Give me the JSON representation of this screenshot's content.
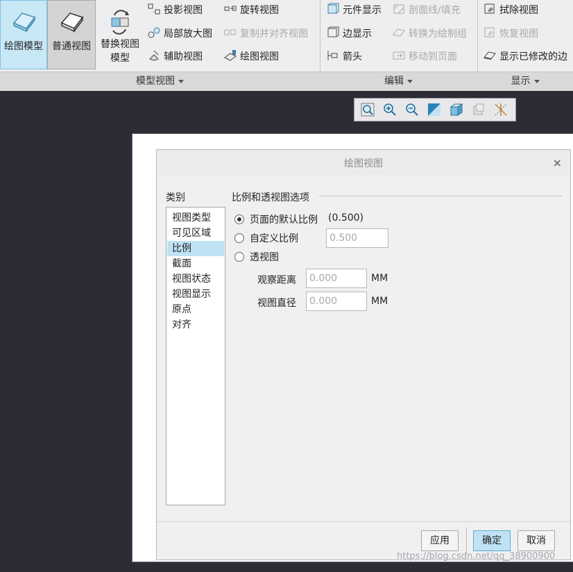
{
  "ribbon": {
    "big_buttons": [
      {
        "label": "绘图模型",
        "state": "active"
      },
      {
        "label": "普通视图",
        "state": "pressed"
      },
      {
        "label": "替换视图\n模型",
        "state": "normal"
      }
    ],
    "model_view_items": [
      {
        "label": "投影视图",
        "disabled": false
      },
      {
        "label": "局部放大图",
        "disabled": false
      },
      {
        "label": "辅助视图",
        "disabled": false
      },
      {
        "label": "旋转视图",
        "disabled": false
      },
      {
        "label": "复制并对齐视图",
        "disabled": true
      },
      {
        "label": "绘图视图",
        "disabled": false
      }
    ],
    "edit_items": [
      {
        "label": "元件显示",
        "disabled": false
      },
      {
        "label": "边显示",
        "disabled": false
      },
      {
        "label": "箭头",
        "disabled": false
      },
      {
        "label": "剖面线/填充",
        "disabled": true
      },
      {
        "label": "转换为绘制组",
        "disabled": true
      },
      {
        "label": "移动到页面",
        "disabled": true
      }
    ],
    "display_items": [
      {
        "label": "拭除视图",
        "disabled": false
      },
      {
        "label": "恢复视图",
        "disabled": true
      },
      {
        "label": "显示已修改的边",
        "disabled": false
      }
    ],
    "groups": [
      {
        "label": "模型视图"
      },
      {
        "label": "编辑"
      },
      {
        "label": "显示"
      }
    ]
  },
  "mini_toolbar": {
    "icons": [
      "zoom-fit-icon",
      "zoom-in-icon",
      "zoom-out-icon",
      "repaint-icon",
      "display-style-icon",
      "saved-views-icon",
      "datum-display-icon"
    ]
  },
  "dialog": {
    "title": "绘图视图",
    "close_glyph": "×",
    "category_label": "类别",
    "categories": [
      "视图类型",
      "可见区域",
      "比例",
      "截面",
      "视图状态",
      "视图显示",
      "原点",
      "对齐"
    ],
    "selected_category": "比例",
    "options_title": "比例和透视图选项",
    "radio_default": "页面的默认比例",
    "default_scale_value": "(0.500)",
    "radio_custom": "自定义比例",
    "custom_scale_value": "0.500",
    "radio_perspective": "透视图",
    "view_distance_label": "观察距离",
    "view_distance_value": "0.000",
    "view_diameter_label": "视图直径",
    "view_diameter_value": "0.000",
    "unit": "MM",
    "selected_radio": "default",
    "buttons": {
      "apply": "应用",
      "ok": "确定",
      "cancel": "取消"
    }
  },
  "watermark": "https://blog.csdn.net/qq_38900900",
  "colors": {
    "accent": "#bfe3f5",
    "canvas": "#2c2c34",
    "ribbon": "#eeeef0"
  }
}
